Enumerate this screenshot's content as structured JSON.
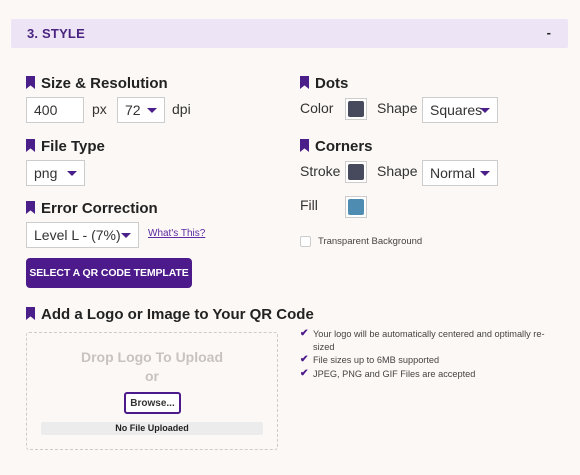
{
  "section": {
    "title": "3. STYLE",
    "toggle": "-"
  },
  "size": {
    "heading": "Size & Resolution",
    "width_value": "400",
    "unit": "px",
    "dpi_value": "72",
    "dpi_unit": "dpi"
  },
  "filetype": {
    "heading": "File Type",
    "value": "png"
  },
  "error": {
    "heading": "Error Correction",
    "value": "Level L - (7%)",
    "help_link": "What's This?"
  },
  "template_button": "SELECT A QR CODE TEMPLATE",
  "dots": {
    "heading": "Dots",
    "color_label": "Color",
    "color": "#474a5c",
    "shape_label": "Shape",
    "shape_value": "Squares"
  },
  "corners": {
    "heading": "Corners",
    "stroke_label": "Stroke",
    "stroke_color": "#474a5c",
    "shape_label": "Shape",
    "shape_value": "Normal",
    "fill_label": "Fill",
    "fill_color": "#4e8cb2"
  },
  "transparent": {
    "label": "Transparent Background",
    "checked": false
  },
  "logo": {
    "heading": "Add a Logo or Image to Your QR Code",
    "drop_text": "Drop Logo To Upload",
    "or_text": "or",
    "browse_label": "Browse...",
    "file_status": "No File Uploaded",
    "notes": [
      "Your logo will be automatically centered and optimally re-sized",
      "File sizes up to 6MB supported",
      "JPEG, PNG and GIF Files are accepted"
    ]
  }
}
